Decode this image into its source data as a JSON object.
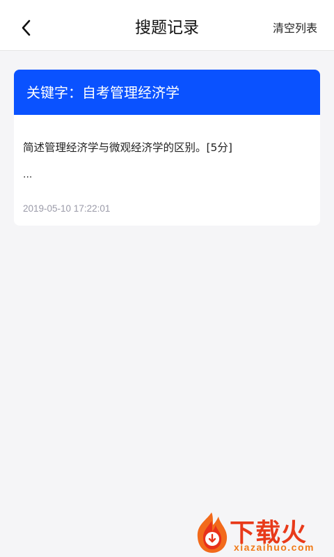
{
  "header": {
    "title": "搜题记录",
    "clear_label": "清空列表"
  },
  "records": [
    {
      "keyword_label": "关键字：",
      "keyword": "自考管理经济学",
      "question": "简述管理经济学与微观经济学的区别。[5分]",
      "ellipsis": "...",
      "timestamp": "2019-05-10 17:22:01"
    }
  ],
  "watermark": {
    "brand": "下载火",
    "url": "xiazaihuo.com"
  },
  "colors": {
    "accent": "#0a52ff",
    "background": "#f5f5f7",
    "timestamp": "#9a9aa8",
    "watermark": "#e83a1a"
  },
  "icons": {
    "back": "chevron-left-icon",
    "watermark_logo": "flame-logo-icon"
  }
}
